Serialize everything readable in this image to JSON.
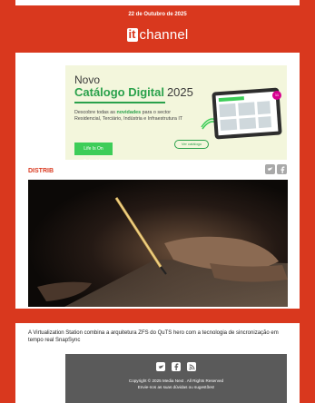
{
  "header": {
    "date": "22 de Outubro de 2025",
    "logo_it": "it",
    "logo_channel": "channel"
  },
  "banner": {
    "novo": "Novo",
    "catalogo": "Catálogo Digital",
    "year": "2025",
    "desc_prefix": "Descobre todas as ",
    "desc_bold": "novidades",
    "desc_rest": " para o sector Residencial, Terciário, Indústria e Infraestrutura IT",
    "brand_button": "Life Is On Schneider",
    "cta": "Ver catálogo",
    "badge": "11"
  },
  "section": {
    "label": "DISTRIB"
  },
  "article": {
    "text": "A Virtualization Station combina a arquitetura ZFS do QuTS hero com a tecnologia de sincronização em tempo real SnapSync"
  },
  "footer": {
    "copyright": "Copyright © 2025 Media Next . All Rights Reserved",
    "contact": "Envie-nos as suas dúvidas ou sugestões!"
  },
  "colors": {
    "brand_red": "#d9381e",
    "footer_gray": "#5a5a5a",
    "schneider_green": "#3dcd58"
  },
  "icons": [
    "twitter-icon",
    "facebook-icon",
    "rss-icon"
  ]
}
